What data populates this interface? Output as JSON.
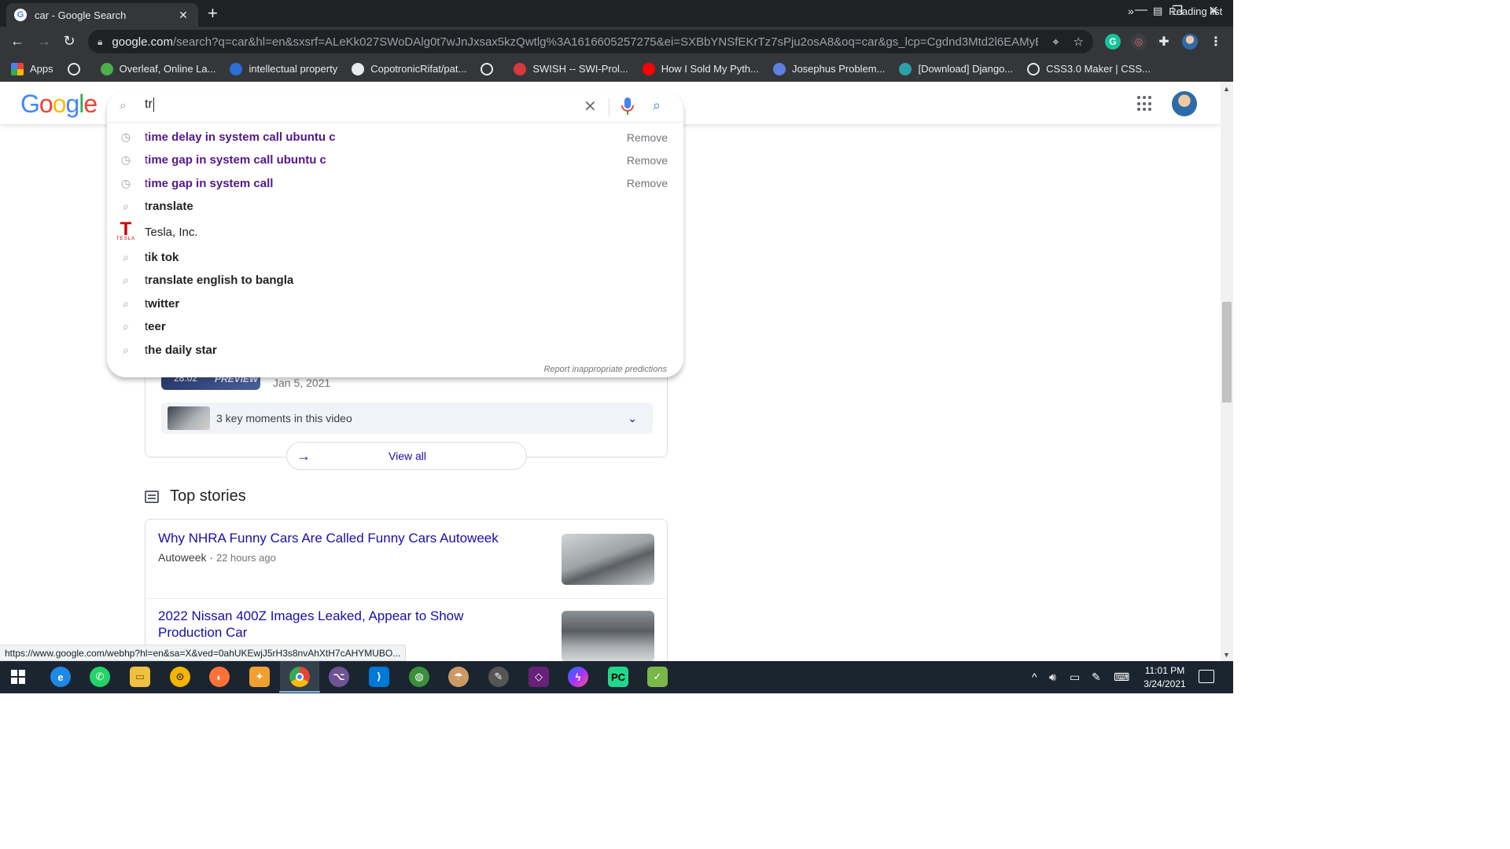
{
  "browser": {
    "tab_title": "car - Google Search",
    "url_host": "google.com",
    "url_path": "/search?q=car&hl=en&sxsrf=ALeKk027SWoDAlg0t7wJnJxsax5kzQwtlg%3A1616605257275&ei=SXBbYNSfEKrTz7sPju2osA8&oq=car&gs_lcp=Cgdnd3Mtd2l6EAMyBAgjECcy...",
    "bookmarks": [
      {
        "label": "Apps",
        "icon": "apps-icon",
        "color": "#e8eaed"
      },
      {
        "label": "",
        "icon": "globe-icon",
        "color": "#e8eaed"
      },
      {
        "label": "Overleaf, Online La...",
        "icon": "overleaf-icon",
        "color": "#4cae4c"
      },
      {
        "label": "intellectual property",
        "icon": "s-icon",
        "color": "#2a6ed8"
      },
      {
        "label": "CopotronicRifat/pat...",
        "icon": "github-icon",
        "color": "#e8eaed"
      },
      {
        "label": "",
        "icon": "globe-icon",
        "color": "#e8eaed"
      },
      {
        "label": "SWISH -- SWI-Prol...",
        "icon": "swish-icon",
        "color": "#d63b3b"
      },
      {
        "label": "How I Sold My Pyth...",
        "icon": "youtube-icon",
        "color": "#ff0000"
      },
      {
        "label": "Josephus Problem...",
        "icon": "spinner-icon",
        "color": "#5f7fe0"
      },
      {
        "label": "[Download] Django...",
        "icon": "django-icon",
        "color": "#2aa1a8"
      },
      {
        "label": "CSS3.0 Maker | CSS...",
        "icon": "globe-icon",
        "color": "#e8eaed"
      }
    ],
    "bookmarks_more": "»",
    "reading_list": "Reading list"
  },
  "search": {
    "query": "tr",
    "suggestions": [
      {
        "type": "history",
        "typed": "t",
        "rest": "ime delay in system call ubuntu c",
        "remove": "Remove"
      },
      {
        "type": "history",
        "typed": "t",
        "rest": "ime gap in system call ubuntu c",
        "remove": "Remove"
      },
      {
        "type": "history",
        "typed": "t",
        "rest": "ime gap in system call",
        "remove": "Remove"
      },
      {
        "type": "query",
        "typed": "t",
        "rest": "ranslate"
      },
      {
        "type": "entity",
        "typed": "",
        "rest": "Tesla, Inc.",
        "logo_text": "TESLA"
      },
      {
        "type": "query",
        "typed": "t",
        "rest": "ik tok"
      },
      {
        "type": "query",
        "typed": "t",
        "rest": "ranslate english to bangla"
      },
      {
        "type": "query",
        "typed": "t",
        "rest": "witter"
      },
      {
        "type": "query",
        "typed": "t",
        "rest": "eer"
      },
      {
        "type": "query",
        "typed": "t",
        "rest": "he daily star"
      }
    ],
    "report": "Report inappropriate predictions"
  },
  "video": {
    "duration": "28:02",
    "preview": "PREVIEW",
    "date": "Jan 5, 2021",
    "moments": "3 key moments in this video",
    "view_all": "View all"
  },
  "top_stories": {
    "heading": "Top stories",
    "items": [
      {
        "headline": "Why NHRA Funny Cars Are Called Funny Cars Autoweek",
        "source": "Autoweek",
        "ago": "22 hours ago"
      },
      {
        "headline": "2022 Nissan 400Z Images Leaked, Appear to Show Production Car",
        "source": "",
        "ago": ""
      }
    ]
  },
  "status_url": "https://www.google.com/webhp?hl=en&sa=X&ved=0ahUKEwjJ5rH3s8nvAhXtH7cAHYMUBO...",
  "taskbar": {
    "time": "11:01 PM",
    "date": "3/24/2021"
  },
  "colors": {
    "history_suggestion": "#52188c",
    "link": "#1a0dab",
    "chrome_dark": "#35363a"
  }
}
